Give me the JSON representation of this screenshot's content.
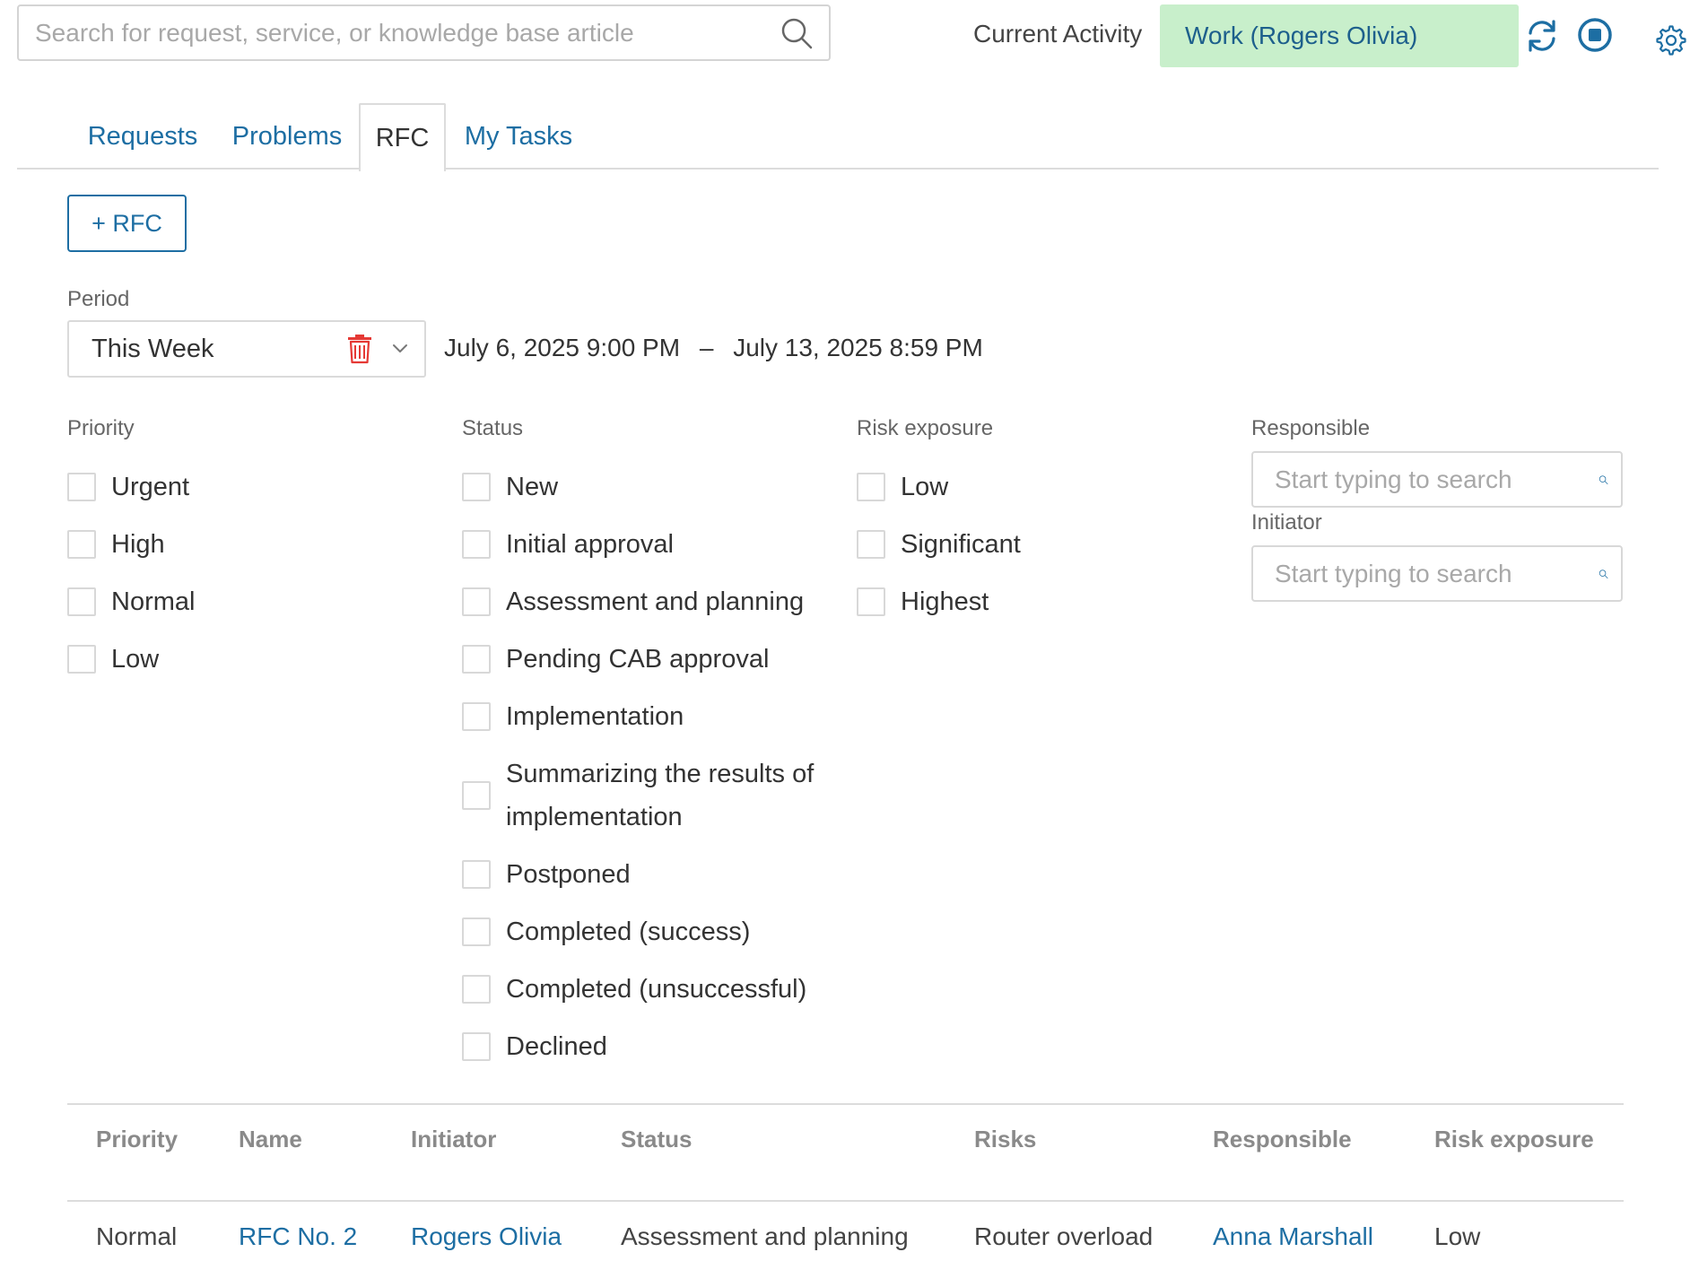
{
  "header": {
    "search_placeholder": "Search for request, service, or knowledge base article",
    "current_activity_label": "Current Activity",
    "current_activity_value": "Work (Rogers Olivia)",
    "icons": [
      "search-icon",
      "refresh-icon",
      "stop-icon",
      "gear-icon"
    ]
  },
  "tabs": [
    {
      "label": "Requests",
      "active": false
    },
    {
      "label": "Problems",
      "active": false
    },
    {
      "label": "RFC",
      "active": true
    },
    {
      "label": "My Tasks",
      "active": false
    }
  ],
  "add_button_label": "+ RFC",
  "period": {
    "label": "Period",
    "selected": "This Week",
    "range_start": "July 6, 2025 9:00 PM",
    "range_separator": "–",
    "range_end": "July 13, 2025 8:59 PM"
  },
  "filters": {
    "priority": {
      "label": "Priority",
      "options": [
        "Urgent",
        "High",
        "Normal",
        "Low"
      ]
    },
    "status": {
      "label": "Status",
      "options": [
        "New",
        "Initial approval",
        "Assessment and planning",
        "Pending CAB approval",
        "Implementation",
        "Summarizing the results of implementation",
        "Postponed",
        "Completed (success)",
        "Completed (unsuccessful)",
        "Declined"
      ]
    },
    "risk_exposure": {
      "label": "Risk exposure",
      "options": [
        "Low",
        "Significant",
        "Highest"
      ]
    },
    "responsible": {
      "label": "Responsible",
      "placeholder": "Start typing to search"
    },
    "initiator": {
      "label": "Initiator",
      "placeholder": "Start typing to search"
    }
  },
  "table": {
    "columns": [
      "Priority",
      "Name",
      "Initiator",
      "Status",
      "Risks",
      "Responsible",
      "Risk exposure"
    ],
    "rows": [
      {
        "priority": "Normal",
        "name": "RFC No. 2",
        "initiator": "Rogers Olivia",
        "status": "Assessment and planning",
        "risks": "Router overload",
        "responsible": "Anna Marshall",
        "risk_exposure": "Low"
      }
    ]
  },
  "colors": {
    "accent": "#1d6ea3",
    "activity_badge": "#c8efcb",
    "delete_icon": "#e53935"
  }
}
